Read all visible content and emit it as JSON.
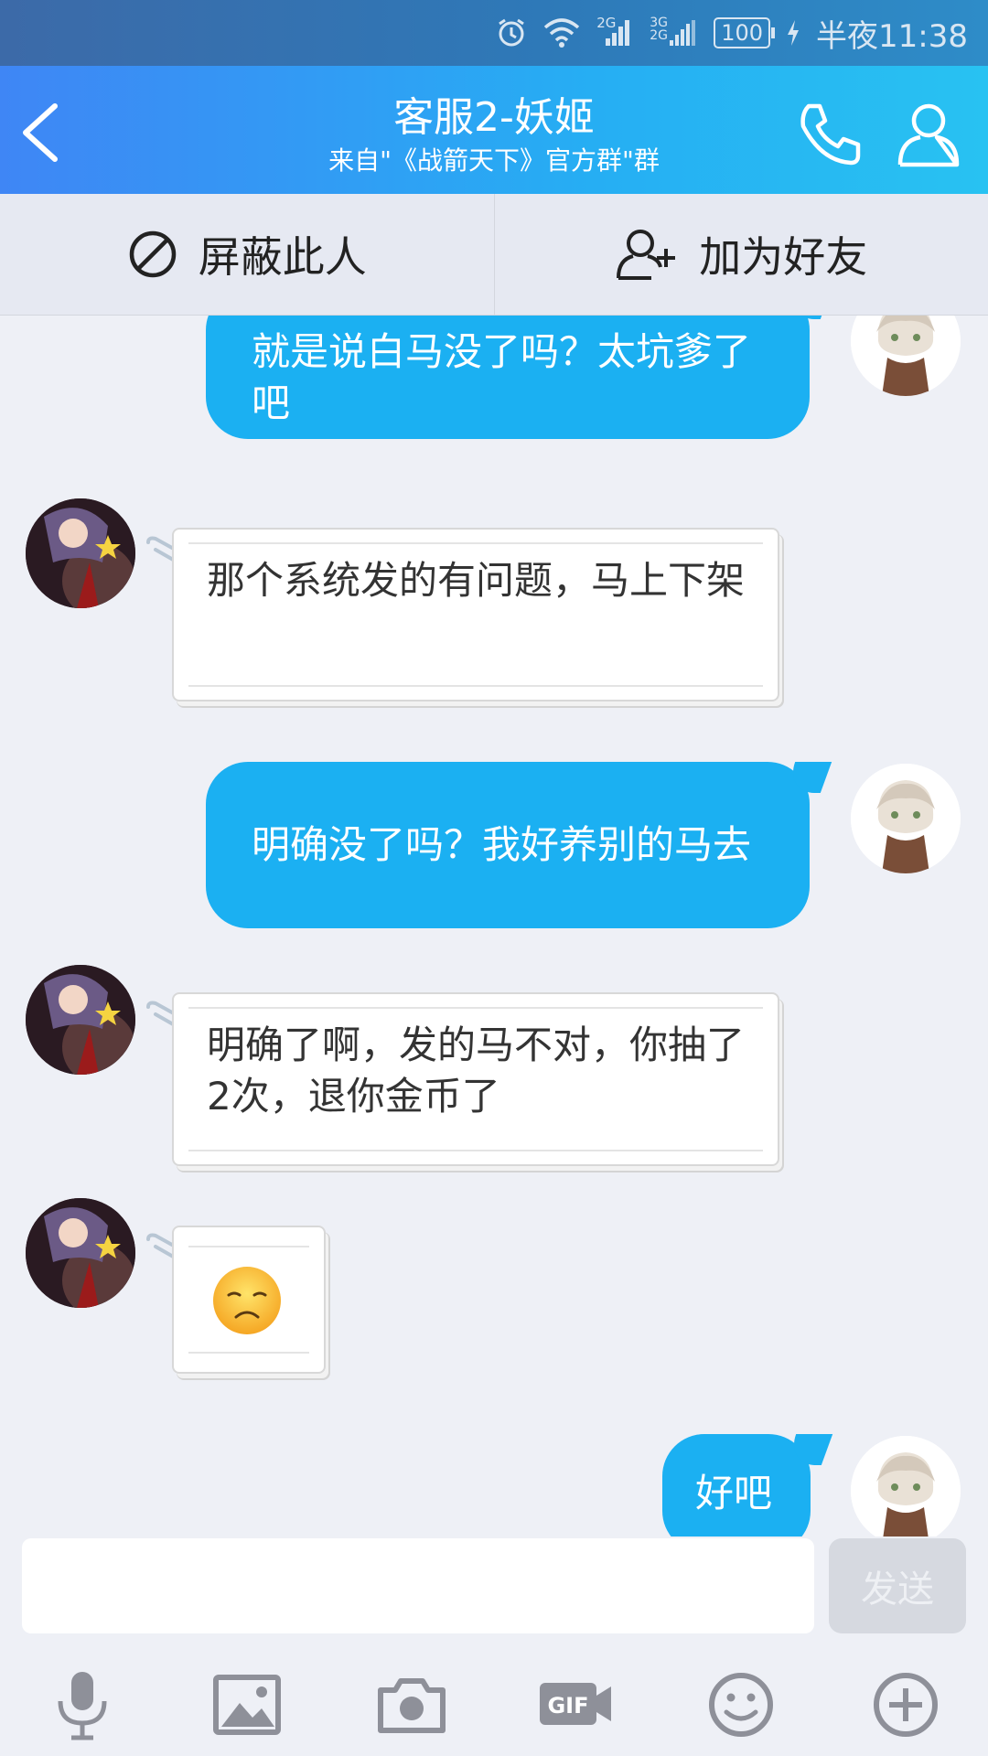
{
  "status_bar": {
    "network_1": "2G",
    "network_2": "3G 2G",
    "battery": "100",
    "time": "半夜11:38"
  },
  "header": {
    "title": "客服2-妖姬",
    "subtitle": "来自\"《战箭天下》官方群\"群"
  },
  "actions": {
    "block_label": "屏蔽此人",
    "add_friend_label": "加为好友"
  },
  "messages": [
    {
      "from": "self",
      "text": "就是说白马没了吗？太坑爹了吧"
    },
    {
      "from": "other",
      "text": "那个系统发的有问题，马上下架"
    },
    {
      "from": "self",
      "text": "明确没了吗？我好养别的马去"
    },
    {
      "from": "other",
      "text": "明确了啊，发的马不对，你抽了2次，退你金币了"
    },
    {
      "from": "other",
      "emoji": "☹"
    },
    {
      "from": "self",
      "text": "好吧"
    }
  ],
  "input": {
    "value": "",
    "send_label": "发送"
  },
  "toolbar": {
    "icons": [
      "microphone-icon",
      "image-icon",
      "camera-icon",
      "gif-icon",
      "emoji-icon",
      "plus-icon"
    ]
  },
  "colors": {
    "outgoing_bubble": "#1bb0f2",
    "header_start": "#3f86f5",
    "header_end": "#28c2f2"
  }
}
